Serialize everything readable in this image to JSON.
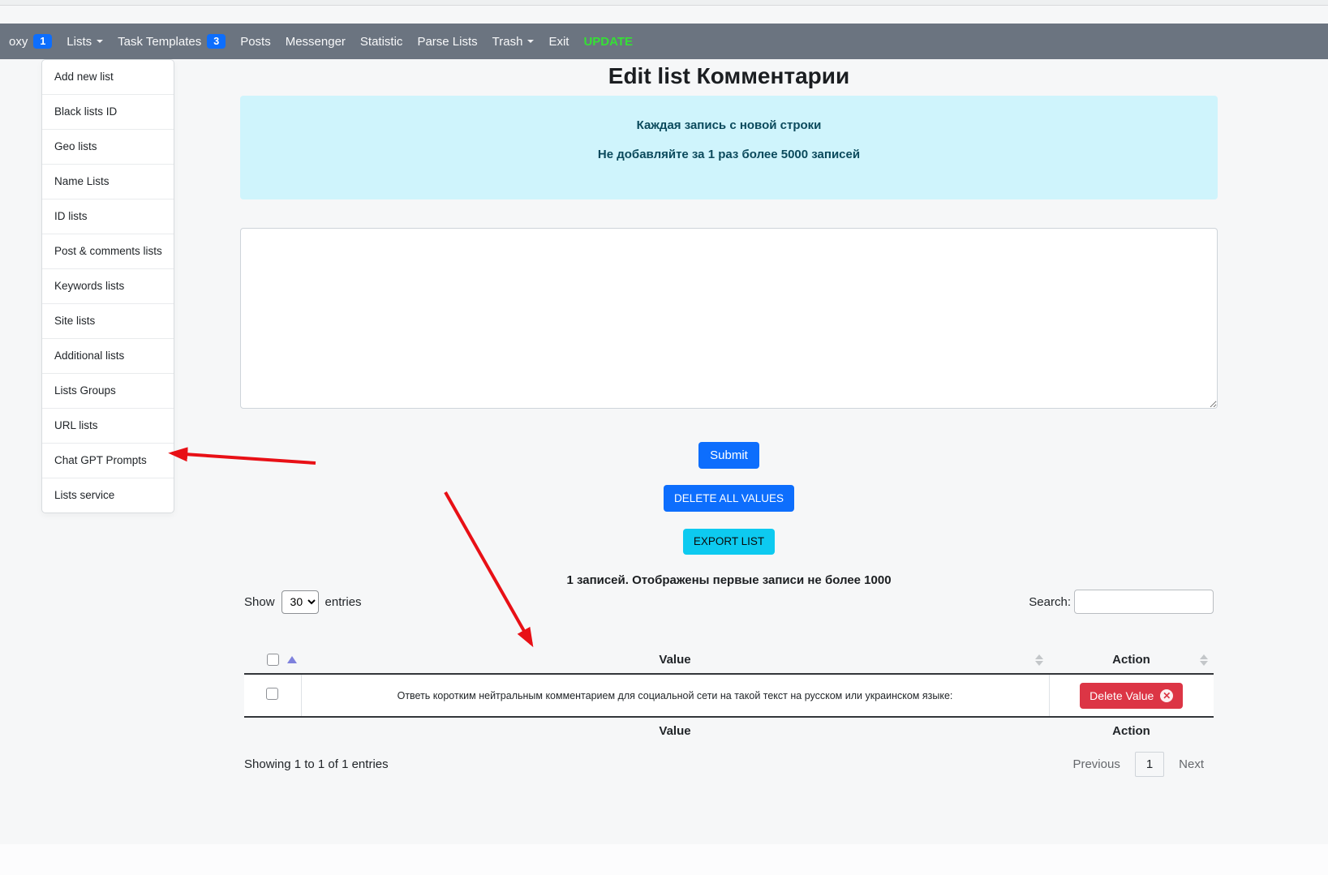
{
  "navbar": {
    "items": [
      {
        "label": "oxy",
        "badge": "1"
      },
      {
        "label": "Lists"
      },
      {
        "label": "Task Templates",
        "badge": "3"
      },
      {
        "label": "Posts"
      },
      {
        "label": "Messenger"
      },
      {
        "label": "Statistic"
      },
      {
        "label": "Parse Lists"
      },
      {
        "label": "Trash"
      },
      {
        "label": "Exit"
      },
      {
        "label": "UPDATE"
      }
    ]
  },
  "lists_menu": {
    "items": [
      "Add new list",
      "Black lists ID",
      "Geo lists",
      "Name Lists",
      "ID lists",
      "Post & comments lists",
      "Keywords lists",
      "Site lists",
      "Additional lists",
      "Lists Groups",
      "URL lists",
      "Chat GPT Prompts",
      "Lists service"
    ]
  },
  "main": {
    "title": "Edit list Комментарии",
    "alert_line1": "Каждая запись с новой строки",
    "alert_line2": "Не добавляйте за 1 раз более 5000 записей",
    "textarea_value": "",
    "submit_label": "Submit",
    "delete_all_label": "DELETE ALL VALUES",
    "export_label": "EXPORT LIST",
    "records_note": "1 записей. Отображены первые записи не более 1000"
  },
  "table": {
    "show_label": "Show",
    "page_length": "30",
    "entries_label": "entries",
    "search_label": "Search:",
    "search_value": "",
    "header": {
      "value": "Value",
      "action": "Action"
    },
    "rows": [
      {
        "value": "Ответь коротким нейтральным комментарием для социальной сети на такой текст на русском или украинском языке:",
        "action_label": "Delete Value"
      }
    ],
    "footer": {
      "value": "Value",
      "action": "Action"
    },
    "info": "Showing 1 to 1 of 1 entries",
    "pagination": {
      "previous": "Previous",
      "page": "1",
      "next": "Next"
    }
  },
  "colors": {
    "navbar_bg": "#6b7480",
    "badge_blue": "#0d6efd",
    "update_green": "#35e035",
    "alert_bg": "#cff4fc",
    "alert_text": "#0b4a5c",
    "primary_blue": "#0d6efd",
    "info_cyan": "#0dcaf0",
    "danger_red": "#dc3545",
    "sort_asc_purple": "#7e81dd",
    "annotation_arrow_red": "#e81016"
  }
}
